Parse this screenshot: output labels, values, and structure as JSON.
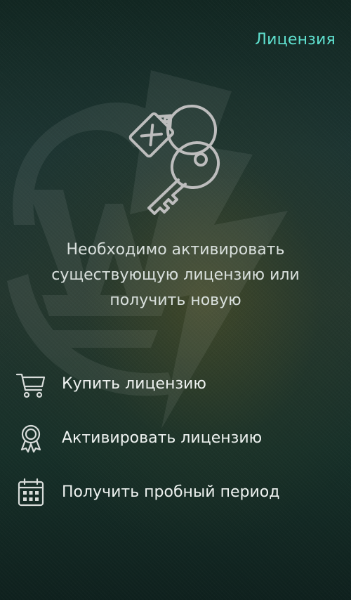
{
  "header": {
    "title": "Лицензия"
  },
  "main": {
    "illustration": "license-keys-icon",
    "description_lines": [
      "Необходимо активировать",
      "существующую лицензию или",
      "получить новую"
    ]
  },
  "menu": {
    "items": [
      {
        "icon": "cart-icon",
        "label": "Купить лицензию"
      },
      {
        "icon": "award-icon",
        "label": "Активировать лицензию"
      },
      {
        "icon": "calendar-icon",
        "label": "Получить пробный период"
      }
    ]
  },
  "colors": {
    "accent": "#5fe0cf",
    "text": "#e6ebe8",
    "icon": "#bdbdbd"
  }
}
